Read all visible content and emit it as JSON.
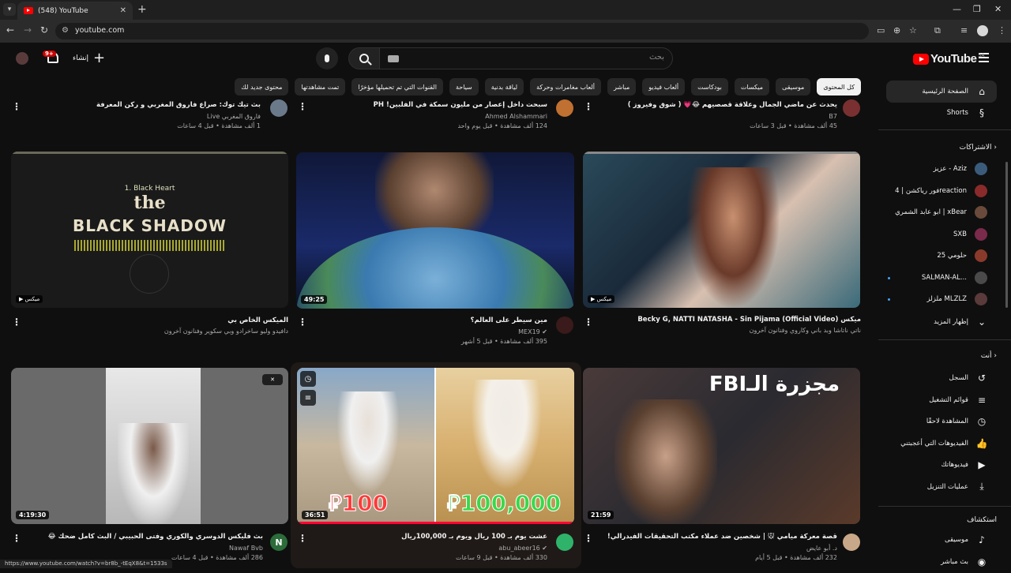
{
  "browser": {
    "tab_title": "(548) YouTube",
    "url": "youtube.com",
    "status_url": "https://www.youtube.com/watch?v=br8b_-tEqX8&t=1533s"
  },
  "masthead": {
    "logo_text": "YouTube",
    "country_code": "SA",
    "search_placeholder": "بحث",
    "create_label": "إنشاء",
    "notif_badge": "9+"
  },
  "chips": [
    "كل المحتوى",
    "موسيقى",
    "ميكسات",
    "بودكاست",
    "ألعاب فيديو",
    "مباشر",
    "ألعاب مغامرات وحركة",
    "لياقة بدنية",
    "سياحة",
    "القنوات التي تم تحميلها مؤخرًا",
    "تمت مشاهدتها",
    "محتوى جديد لك"
  ],
  "sidebar": {
    "home": "الصفحة الرئيسية",
    "shorts": "Shorts",
    "subs_header": "الاشتراكات",
    "subs": [
      {
        "label": "عزيز - Aziz",
        "color": "#3b5b7a",
        "dot": false
      },
      {
        "label": "فور رياكشن | 4reaction",
        "color": "#8a2a2a",
        "dot": false
      },
      {
        "label": "ابو عابد الشمري | xBear",
        "color": "#6a4a3a",
        "dot": false
      },
      {
        "label": "SXB",
        "color": "#7a2a4a",
        "dot": false
      },
      {
        "label": "حلومي 25",
        "color": "#8a3a2a",
        "dot": false
      },
      {
        "label": "SALMAN-AL...",
        "color": "#4a4a4a",
        "dot": true
      },
      {
        "label": "ملزلز MLZLZ",
        "color": "#5a3a3a",
        "dot": true
      }
    ],
    "show_more": "إظهار المزيد",
    "you_header": "أنت",
    "you_items": [
      {
        "label": "السجل",
        "icon": "history-icon",
        "glyph": "↺"
      },
      {
        "label": "قوائم التشغيل",
        "icon": "playlists-icon",
        "glyph": "≡"
      },
      {
        "label": "المشاهدة لاحقًا",
        "icon": "watch-later-icon",
        "glyph": "◷"
      },
      {
        "label": "الفيديوهات التي أعجبتني",
        "icon": "like-icon",
        "glyph": "👍"
      },
      {
        "label": "فيديوهاتك",
        "icon": "your-videos-icon",
        "glyph": "▶"
      },
      {
        "label": "عمليات التنزيل",
        "icon": "download-icon",
        "glyph": "⤓"
      }
    ],
    "explore_header": "استكشاف",
    "explore_items": [
      {
        "label": "موسيقى",
        "icon": "music-icon",
        "glyph": "♪"
      },
      {
        "label": "بث مباشر",
        "icon": "live-icon",
        "glyph": "◉"
      }
    ]
  },
  "top_row": [
    {
      "title": "يحدث عن ماضي الجمال وعلاقة قصصيهم 😂💗 ( شوق وفيروز )",
      "channel": "B7",
      "meta": "45 ألف مشاهدة • قبل 3 ساعات",
      "avatar": "#7a3030"
    },
    {
      "title": "سبحت داخل إعصار من مليون سمكة في الفلبين! PH",
      "channel": "Ahmed Alshammari",
      "meta": "124 ألف مشاهدة • قبل يوم واحد",
      "avatar": "#c07030"
    },
    {
      "title": "بث تيك توك: صراع فاروق المغربي و ركن المعرفة",
      "channel": "فاروق المغربي Live",
      "meta": "1 ألف مشاهدة • قبل 4 ساعات",
      "avatar": "#6a7a8a"
    }
  ],
  "middle_row": [
    {
      "title": "ميكس Becky G, NATTI NATASHA - Sin Pijama (Official Video)",
      "channel": "ناتي ناتاشا وبد باني وكاروي وفنانون آخرون",
      "meta": "",
      "badge": "ميكس",
      "duration": ""
    },
    {
      "title": "مين سيطر على العالم؟",
      "channel": "MEX19",
      "meta": "395 ألف مشاهدة • قبل 5 أشهر",
      "badge": "",
      "duration": "49:25",
      "avatar": "#3a1a1a"
    },
    {
      "title": "الميكس الخاص بي",
      "channel": "دافيدو وليو ساخرادو وبي سكوير وفنانون آخرون",
      "meta": "",
      "badge": "ميكس",
      "duration": "",
      "thumb_title_small": "1. Black Heart",
      "thumb_title_a": "the",
      "thumb_title_b": "BLACK SHADOW"
    }
  ],
  "bottom_row": [
    {
      "title": "قصة معركة ميامي 🐭 | شخصين ضد عملاء مكتب التحقيقات الفيدرالي!",
      "channel": "د. أبو عايض",
      "meta": "232 ألف مشاهدة • قبل 5 أيام",
      "duration": "21:59",
      "avatar": "#c8a888",
      "thumb_text": "مجزرة الـFBI"
    },
    {
      "title": "عشت يوم بـ 100 ريال ويوم بـ 100,000ريال",
      "channel": "abu_abeer16",
      "meta": "330 ألف مشاهدة • قبل 9 ساعات",
      "duration": "36:51",
      "avatar": "#2fb36b",
      "thumb_left": "100",
      "thumb_right": "100,000"
    },
    {
      "title": "بث فليكس الدوسري والكوري وفتى الحبيبي / البث كامل ضحك 😂",
      "channel": "Nawaf Bvb",
      "meta": "286 ألف مشاهدة • قبل 4 ساعات",
      "duration": "4:19:30",
      "avatar": "#2c6b3a",
      "avatar_letter": "N"
    }
  ]
}
